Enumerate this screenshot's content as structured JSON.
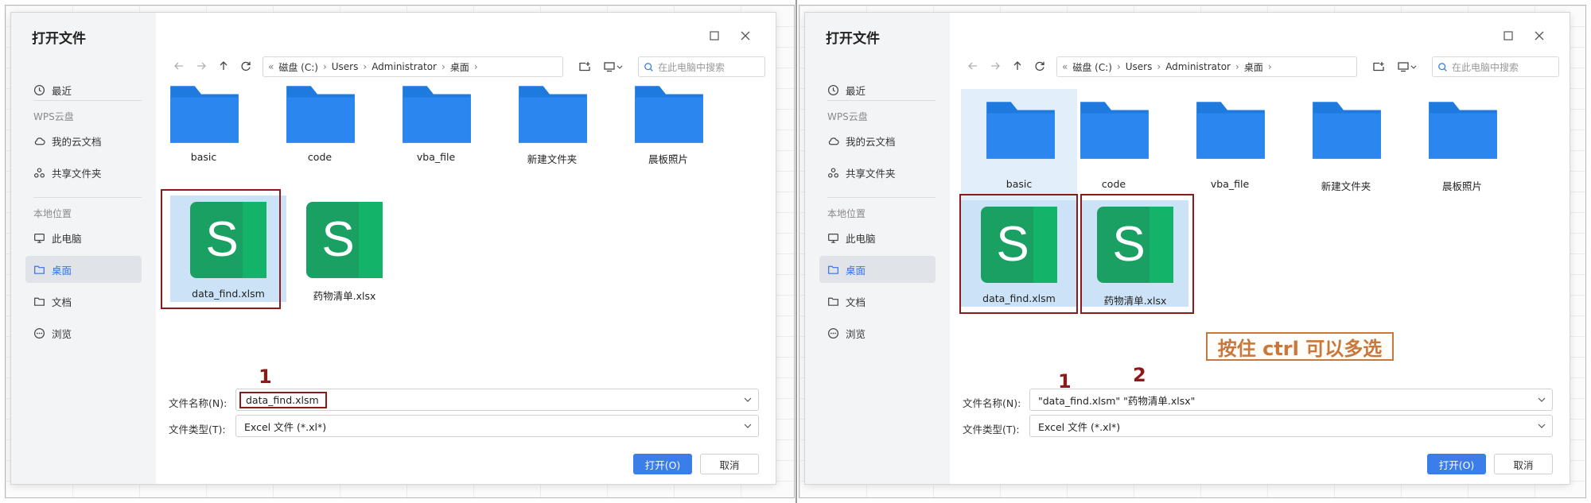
{
  "left_dialog": {
    "title": "打开文件",
    "sidebar": {
      "recent": "最近",
      "wps_cloud_heading": "WPS云盘",
      "my_cloud": "我的云文档",
      "shared_folder": "共享文件夹",
      "local_heading": "本地位置",
      "this_pc": "此电脑",
      "desktop": "桌面",
      "documents": "文档",
      "browse": "浏览"
    },
    "breadcrumb": [
      "磁盘 (C:)",
      "Users",
      "Administrator",
      "桌面"
    ],
    "search_placeholder": "在此电脑中搜索",
    "folders": [
      "basic",
      "code",
      "vba_file",
      "新建文件夹",
      "晨板照片"
    ],
    "files": [
      {
        "name": "data_find.xlsm",
        "selected": true
      },
      {
        "name": "药物清单.xlsx",
        "selected": false
      }
    ],
    "filename_label": "文件名称(N):",
    "filename_value": "data_find.xlsm",
    "filetype_label": "文件类型(T):",
    "filetype_value": "Excel 文件 (*.xl*)",
    "open_button": "打开(O)",
    "cancel_button": "取消"
  },
  "right_dialog": {
    "title": "打开文件",
    "sidebar": {
      "recent": "最近",
      "wps_cloud_heading": "WPS云盘",
      "my_cloud": "我的云文档",
      "shared_folder": "共享文件夹",
      "local_heading": "本地位置",
      "this_pc": "此电脑",
      "desktop": "桌面",
      "documents": "文档",
      "browse": "浏览"
    },
    "breadcrumb": [
      "磁盘 (C:)",
      "Users",
      "Administrator",
      "桌面"
    ],
    "search_placeholder": "在此电脑中搜索",
    "folders": [
      "basic",
      "code",
      "vba_file",
      "新建文件夹",
      "晨板照片"
    ],
    "files": [
      {
        "name": "data_find.xlsm",
        "selected": true
      },
      {
        "name": "药物清单.xlsx",
        "selected": true
      }
    ],
    "filename_label": "文件名称(N):",
    "filename_value": "\"data_find.xlsm\" \"药物清单.xlsx\"",
    "filetype_label": "文件类型(T):",
    "filetype_value": "Excel 文件 (*.xl*)",
    "open_button": "打开(O)",
    "cancel_button": "取消"
  },
  "annotations": {
    "left_num_1": "1",
    "right_num_1": "1",
    "right_num_2": "2",
    "tip": "按住 ctrl 可以多选"
  },
  "colors": {
    "accent_blue": "#3b7de9",
    "folder_blue": "#1f7ae0",
    "sheet_green": "#1aa062",
    "annotation_red": "#8b1a1a",
    "tip_orange": "#c9773a"
  },
  "icons": {
    "recent": "clock-icon",
    "cloud": "cloud-icon",
    "shared": "share-icon",
    "pc": "monitor-icon",
    "desktop": "folder-outline-icon",
    "documents": "folder-outline-icon",
    "browse": "ellipsis-circle-icon",
    "folder": "folder-icon",
    "sheet": "wps-sheet-icon"
  }
}
